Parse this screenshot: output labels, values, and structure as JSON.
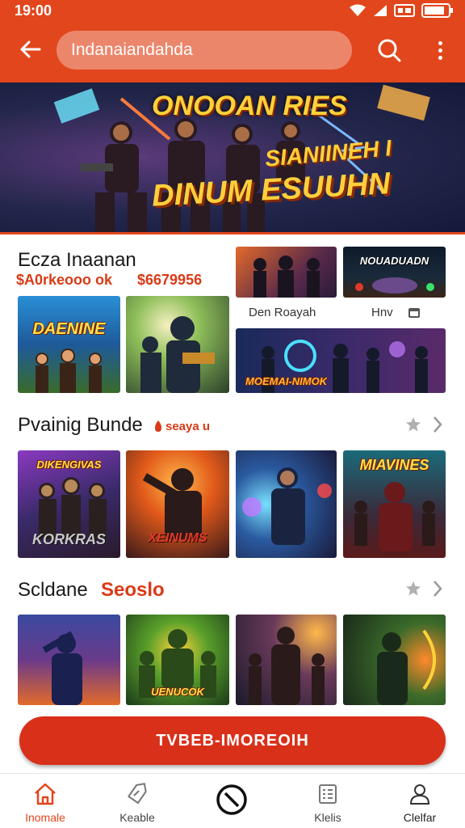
{
  "status_bar": {
    "time": "19:00"
  },
  "app_bar": {
    "search_value": "Indanaiandahda"
  },
  "banner": {
    "line1": "ONOOAN RIES",
    "line2": "SIANIINEH I",
    "line3": "DINUM ESUUHN"
  },
  "section1": {
    "title": "Ecza Inaanan",
    "price_a": "$A0rkeooo ok",
    "price_b": "$6679956",
    "tile_labels": [
      "DAENINE",
      "NOUADUADN",
      "MOEMAI-NIMOK"
    ],
    "label_left": "Den Roayah",
    "label_right": "Hnv"
  },
  "section2": {
    "title": "Pvainig Bunde",
    "subtitle": "seaya u",
    "tile_labels": [
      "DIKENGIVAS",
      "KORKRAS",
      "XEINUMS",
      "MIAVINES"
    ]
  },
  "section3": {
    "title": "Scldane",
    "title_accent": "Seoslo",
    "tile_labels": [
      "UENUCOK"
    ]
  },
  "cta": {
    "label": "TVBEB-IMOREOIH"
  },
  "bottom_nav": {
    "items": [
      {
        "label": "Inomale",
        "icon": "home-icon",
        "active": true
      },
      {
        "label": "Keable",
        "icon": "tag-icon",
        "active": false
      },
      {
        "label": "",
        "icon": "prohibited-icon",
        "active": false
      },
      {
        "label": "Klelis",
        "icon": "list-icon",
        "active": false
      },
      {
        "label": "Clelfar",
        "icon": "profile-icon",
        "active": false
      }
    ]
  },
  "colors": {
    "brand": "#e2461c",
    "cta": "#d9301a",
    "accent_text": "#d93a16",
    "title_yellow": "#ffd23a"
  }
}
